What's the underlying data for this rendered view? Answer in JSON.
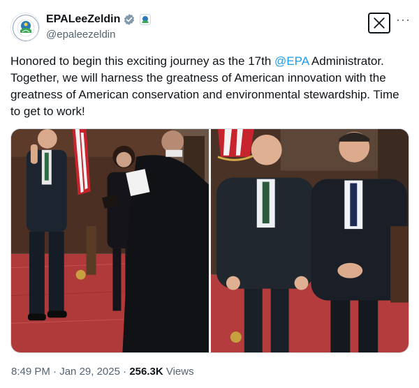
{
  "author": {
    "display_name": "EPALeeZeldin",
    "handle": "@epaleezeldin",
    "avatar_icon": "epa-seal-icon",
    "verified_icon": "verified-badge-icon",
    "affiliation_icon": "epa-affiliation-badge-icon"
  },
  "tweet": {
    "text_before": "Honored to begin this exciting journey as the 17th ",
    "mention": "@EPA",
    "text_after": " Administrator. Together, we will harness the greatness of American innovation with the greatness of American conservation and environmental stewardship. Time to get to work!"
  },
  "media": {
    "photos": [
      {
        "icon": "swearing-in-photo"
      },
      {
        "icon": "two-men-posing-photo"
      }
    ]
  },
  "meta": {
    "time": "8:49 PM",
    "separator": " · ",
    "date": "Jan 29, 2025",
    "views_count": "256.3K",
    "views_label": " Views"
  },
  "colors": {
    "link": "#1d9bf0",
    "text": "#0f1419",
    "secondary": "#536471",
    "verified": "#829aab"
  },
  "controls": {
    "brand_icon": "x-logo-icon",
    "more_icon": "more-options-icon"
  }
}
